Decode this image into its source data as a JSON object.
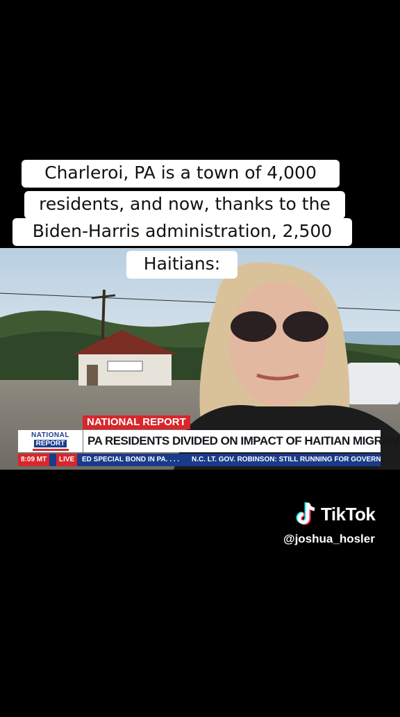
{
  "caption": {
    "lines": [
      "Charleroi, PA is a town of 4,000",
      "residents, and now, thanks to the",
      "Biden-Harris administration, 2,500",
      "Haitians:"
    ]
  },
  "broadcast": {
    "label": "NATIONAL REPORT",
    "logo_top": "NATIONAL",
    "logo_bottom": "REPORT",
    "headline": "PA RESIDENTS DIVIDED ON IMPACT OF HAITIAN MIGRANT INFLUX",
    "ticker_time": "8:09 MT",
    "ticker_live": "LIVE",
    "ticker_item1": "ED SPECIAL BOND IN PA. . . .",
    "ticker_item2": "N.C. LT. GOV. ROBINSON: STILL RUNNING FOR GOVERN",
    "colors": {
      "red": "#d8262b",
      "navy": "#1a3a8a"
    }
  },
  "watermark": {
    "brand": "TikTok",
    "handle": "@joshua_hosler",
    "icon": "tiktok-note-icon"
  }
}
